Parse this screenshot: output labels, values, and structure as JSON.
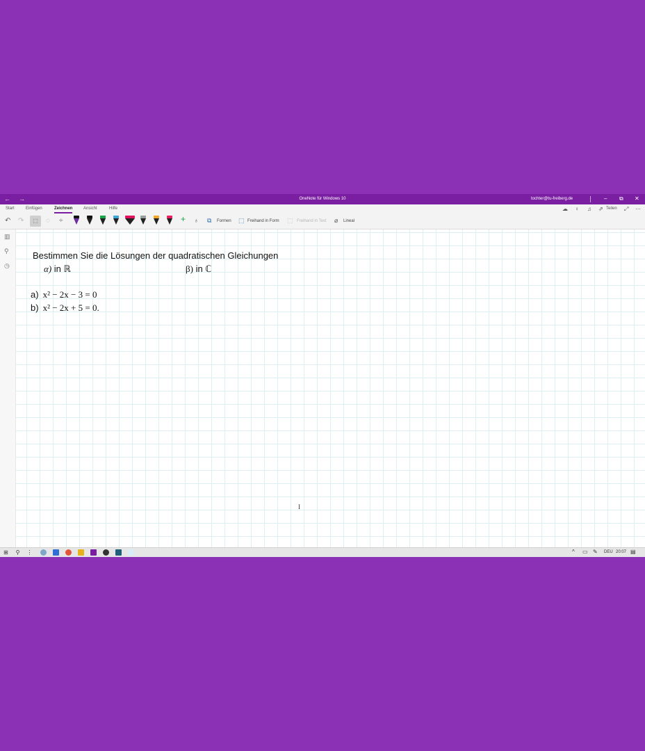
{
  "window": {
    "title": "OneNote für Windows 10",
    "account": "tochter@tu-freiberg.de",
    "back_icon": "←",
    "forward_icon": "→",
    "minimize_icon": "–",
    "restore_icon": "⧉",
    "close_icon": "✕"
  },
  "tabs": [
    {
      "label": "Start"
    },
    {
      "label": "Einfügen"
    },
    {
      "label": "Zeichnen",
      "active": true
    },
    {
      "label": "Ansicht"
    },
    {
      "label": "Hilfe"
    }
  ],
  "share_label": "Teilen",
  "toolbar": {
    "shapes_label": "Formen",
    "ink_to_shape_label": "Freihand in Form",
    "ink_to_text_label": "Freihand in Text",
    "ruler_label": "Lineal",
    "add_pen_icon": "+",
    "pens": [
      {
        "color": "#6b2fa0"
      },
      {
        "color": "#000000"
      },
      {
        "color": "#111111"
      },
      {
        "color": "#1aa34a"
      },
      {
        "color": "#3aa7d8"
      },
      {
        "color": "#e0115f"
      },
      {
        "color": "#9a9a9a"
      },
      {
        "color": "#f5a623"
      },
      {
        "color": "#e81e63"
      }
    ]
  },
  "page": {
    "heading": "Bestimmen Sie die Lösungen der quadratischen Gleichungen",
    "option_a": {
      "symbol": "α)",
      "text": "in ℝ"
    },
    "option_b": {
      "symbol": "β)",
      "text": "in ℂ"
    },
    "equations": [
      {
        "label": "a)",
        "expr": "x² − 2x − 3 = 0"
      },
      {
        "label": "b)",
        "expr": "x² − 2x + 5 = 0."
      }
    ],
    "text_cursor_icon": "I"
  },
  "taskbar": {
    "language": "DEU",
    "time": "20:07"
  },
  "colors": {
    "accent": "#7b1fa2",
    "desktop": "#8a31b5"
  }
}
